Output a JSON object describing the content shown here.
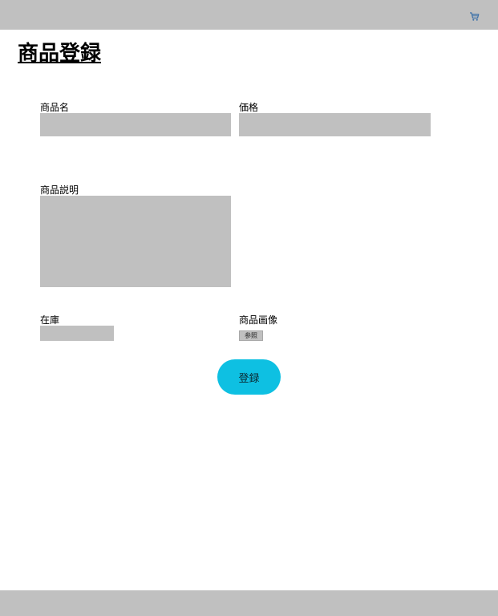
{
  "header": {
    "cart_icon": "cart-icon"
  },
  "page": {
    "title": "商品登録"
  },
  "form": {
    "name_label": "商品名",
    "name_value": "",
    "price_label": "価格",
    "price_value": "",
    "description_label": "商品説明",
    "description_value": "",
    "stock_label": "在庫",
    "stock_value": "",
    "image_label": "商品画像",
    "browse_label": "参照",
    "submit_label": "登録"
  },
  "colors": {
    "header_bg": "#c0c0c0",
    "field_bg": "#c0c0c0",
    "accent": "#0ec0e2",
    "cart_icon": "#3a6fa8"
  }
}
